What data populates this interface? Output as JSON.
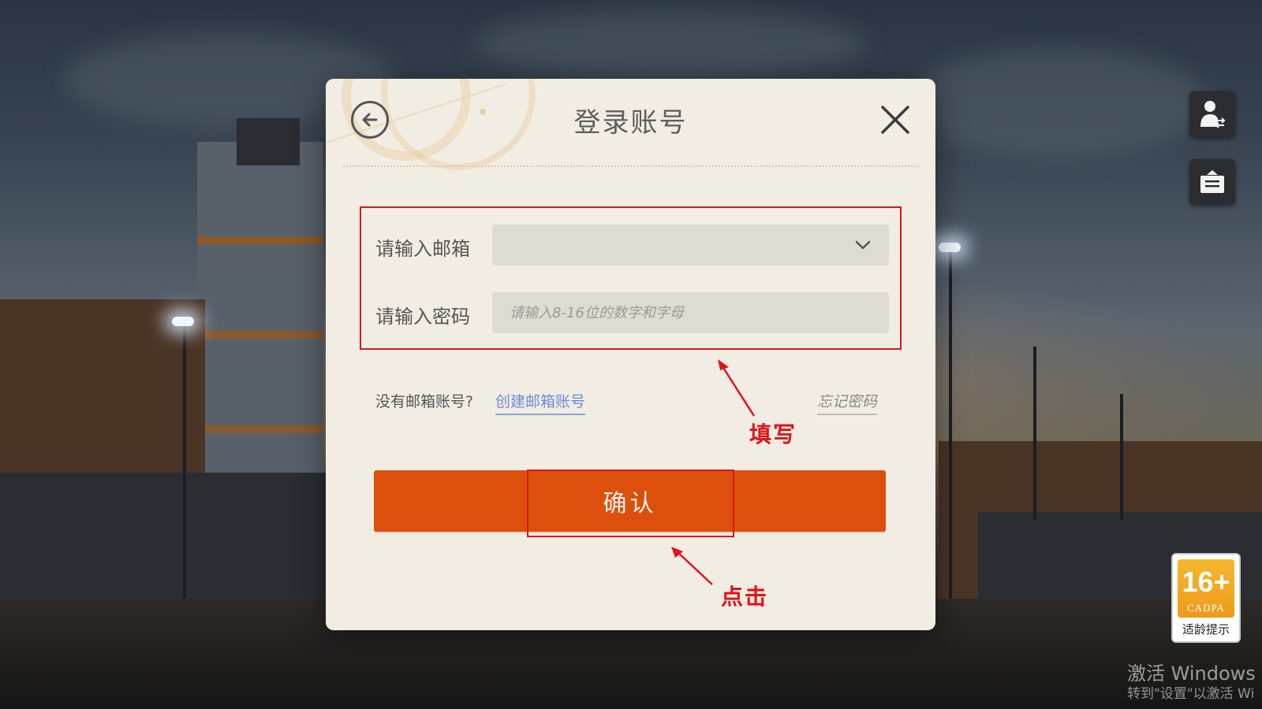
{
  "dialog": {
    "title": "登录账号",
    "email": {
      "label": "请输入邮箱",
      "value": "",
      "placeholder": ""
    },
    "password": {
      "label": "请输入密码",
      "value": "",
      "placeholder": "请输入8-16位的数字和字母"
    },
    "no_account_text": "没有邮箱账号?",
    "create_account_link": "创建邮箱账号",
    "forgot_password_link": "忘记密码",
    "confirm_label": "确认"
  },
  "annotations": {
    "fill_label": "填写",
    "click_label": "点击",
    "color": "#e0141a"
  },
  "side_buttons": [
    {
      "icon": "user-switch-icon"
    },
    {
      "icon": "notice-board-icon"
    }
  ],
  "age_rating": {
    "value": "16+",
    "org": "CADPA",
    "caption": "适龄提示"
  },
  "watermark": {
    "title": "激活 Windows",
    "subtitle": "转到\"设置\"以激活 Wi"
  },
  "colors": {
    "accent": "#dd4f0c",
    "dialog_bg": "#f1ede3",
    "link": "#6c8bd6"
  }
}
